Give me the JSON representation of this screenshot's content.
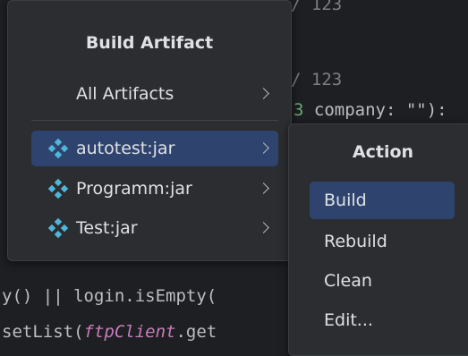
{
  "editor": {
    "line1": "/ 123",
    "line2": "/ 123",
    "line3_prefix": "3",
    "line3_rest": " company: \"\"):",
    "line4": "y() || login.isEmpty(",
    "line5_prefix": "setList(",
    "line5_italic": "ftpClient",
    "line5_suffix": ".get"
  },
  "build_artifact_menu": {
    "title": "Build Artifact",
    "all_artifacts_label": "All Artifacts",
    "items": [
      {
        "label": "autotest:jar",
        "icon": "artifact-icon",
        "selected": true
      },
      {
        "label": "Programm:jar",
        "icon": "artifact-icon",
        "selected": false
      },
      {
        "label": "Test:jar",
        "icon": "artifact-icon",
        "selected": false
      }
    ]
  },
  "action_menu": {
    "title": "Action",
    "items": [
      {
        "label": "Build",
        "selected": true
      },
      {
        "label": "Rebuild",
        "selected": false
      },
      {
        "label": "Clean",
        "selected": false
      },
      {
        "label": "Edit...",
        "selected": false
      }
    ]
  },
  "colors": {
    "background": "#1e1f22",
    "popup": "#2b2d30",
    "selection": "#2e436e",
    "text": "#dfe1e5",
    "artifact_icon": "#4fb5d9"
  }
}
